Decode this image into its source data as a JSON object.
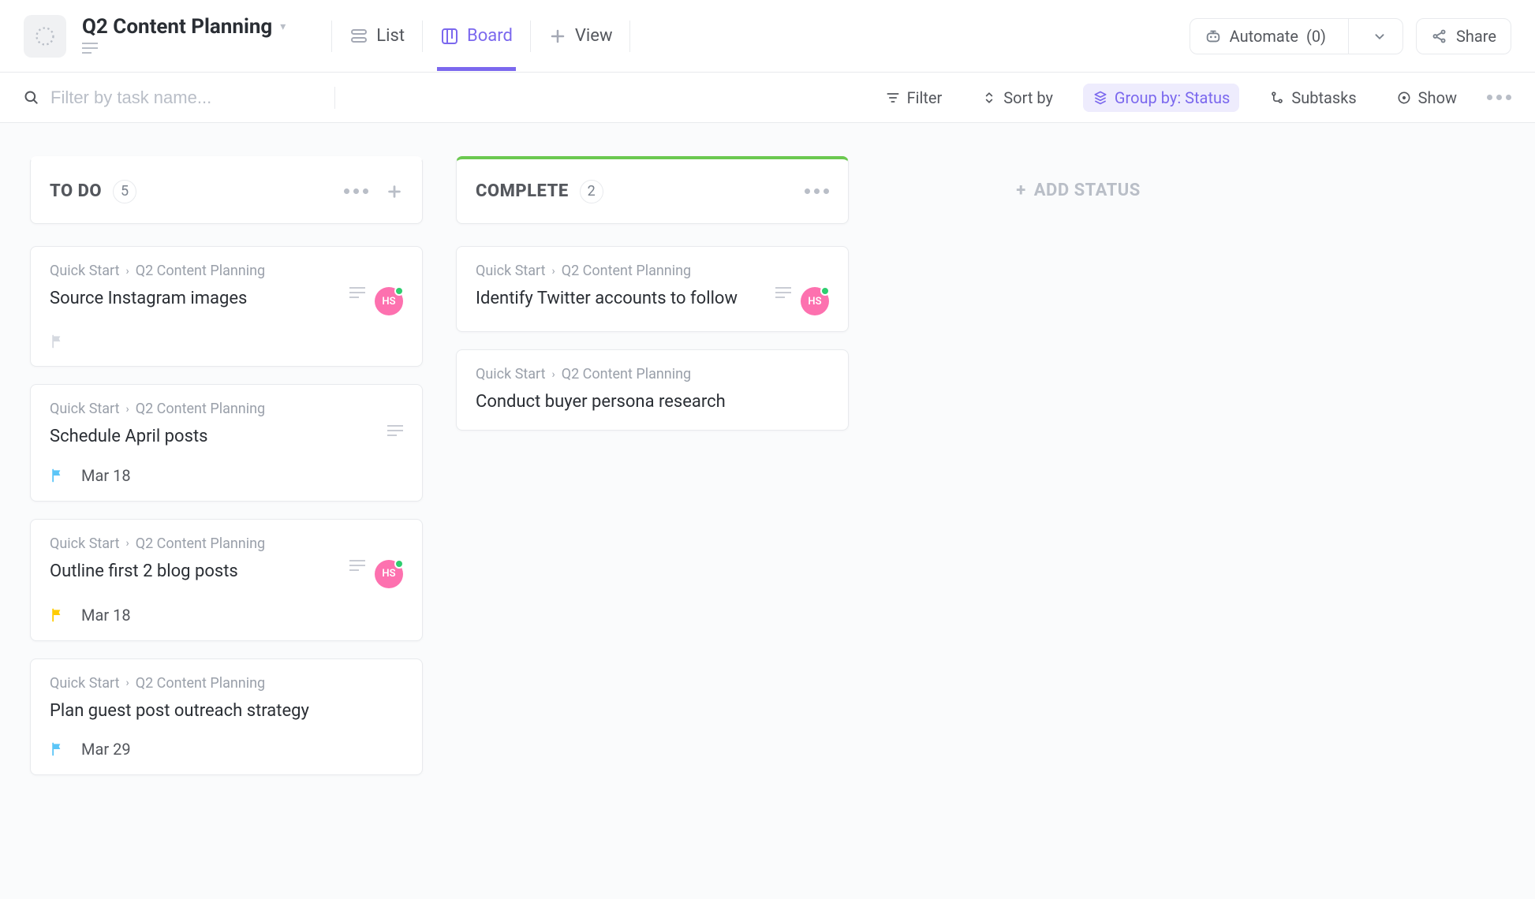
{
  "header": {
    "title": "Q2 Content Planning",
    "views": [
      {
        "id": "list",
        "label": "List",
        "active": false
      },
      {
        "id": "board",
        "label": "Board",
        "active": true
      },
      {
        "id": "view",
        "label": "View",
        "active": false
      }
    ],
    "automate_label": "Automate",
    "automate_count": "(0)",
    "share_label": "Share"
  },
  "toolbar": {
    "search_placeholder": "Filter by task name...",
    "filter": "Filter",
    "sort": "Sort by",
    "group": "Group by: Status",
    "subtasks": "Subtasks",
    "show": "Show"
  },
  "breadcrumb": {
    "root": "Quick Start",
    "leaf": "Q2 Content Planning"
  },
  "assignee": {
    "initials": "HS"
  },
  "board": {
    "add_status_label": "ADD STATUS",
    "columns": [
      {
        "id": "todo",
        "title": "TO DO",
        "count": "5",
        "accent": "none",
        "show_plus": true,
        "cards": [
          {
            "title": "Source Instagram images",
            "has_desc": true,
            "assignee": true,
            "flag": "grey",
            "date": ""
          },
          {
            "title": "Schedule April posts",
            "has_desc": true,
            "assignee": false,
            "flag": "blue",
            "date": "Mar 18"
          },
          {
            "title": "Outline first 2 blog posts",
            "has_desc": true,
            "assignee": true,
            "flag": "yellow",
            "date": "Mar 18"
          },
          {
            "title": "Plan guest post outreach strategy",
            "has_desc": false,
            "assignee": false,
            "flag": "blue",
            "date": "Mar 29"
          }
        ]
      },
      {
        "id": "complete",
        "title": "COMPLETE",
        "count": "2",
        "accent": "complete",
        "show_plus": false,
        "cards": [
          {
            "title": "Identify Twitter accounts to follow",
            "has_desc": true,
            "assignee": true,
            "flag": "",
            "date": ""
          },
          {
            "title": "Conduct buyer persona re­search",
            "has_desc": false,
            "assignee": false,
            "flag": "",
            "date": ""
          }
        ]
      }
    ]
  }
}
